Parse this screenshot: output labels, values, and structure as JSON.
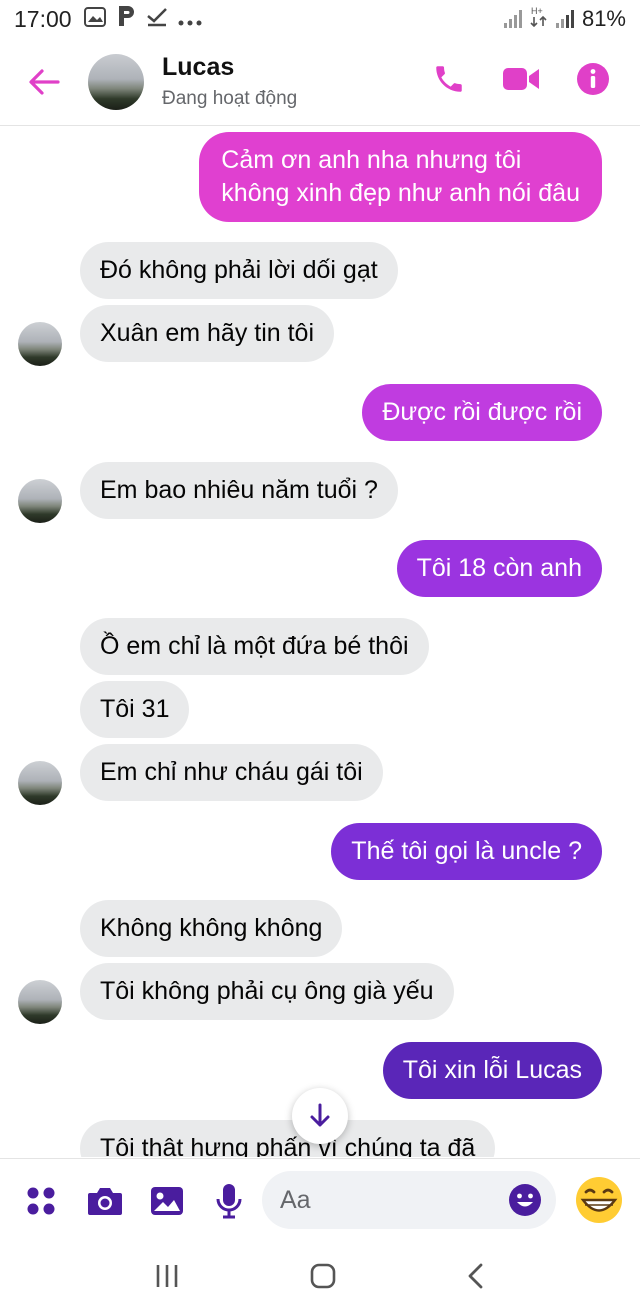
{
  "status_bar": {
    "time": "17:00",
    "battery": "81%",
    "icons": [
      "gallery-icon",
      "parking-icon",
      "check-download-icon",
      "more-dots-icon",
      "signal-icon",
      "data-icon"
    ]
  },
  "header": {
    "contact_name": "Lucas",
    "presence": "Đang hoạt động",
    "accent_color": "#e040c8"
  },
  "messages": [
    {
      "side": "out",
      "text": "Cảm ơn anh nha nhưng tôi",
      "text2": "không xinh đẹp như anh nói đâu",
      "color": "#e040d0"
    },
    {
      "side": "in",
      "text": "Đó không phải lời dối gạt"
    },
    {
      "side": "in",
      "text": "Xuân em hãy tin tôi",
      "avatar": true
    },
    {
      "side": "out",
      "text": "Được rồi được rồi",
      "color": "#c03ce0"
    },
    {
      "side": "in",
      "text": "Em bao nhiêu năm tuổi ?",
      "avatar": true
    },
    {
      "side": "out",
      "text": "Tôi 18 còn anh",
      "color": "#9b34e0"
    },
    {
      "side": "in",
      "text": "Ồ em chỉ là một đứa bé thôi"
    },
    {
      "side": "in",
      "text": "Tôi 31"
    },
    {
      "side": "in",
      "text": "Em chỉ như cháu gái tôi",
      "avatar": true
    },
    {
      "side": "out",
      "text": "Thế tôi gọi là uncle ?",
      "color": "#7c2fd6"
    },
    {
      "side": "in",
      "text": "Không không không"
    },
    {
      "side": "in",
      "text": "Tôi không phải cụ ông già yếu",
      "avatar": true
    },
    {
      "side": "out",
      "text": "Tôi xin lỗi Lucas",
      "color": "#5a26b8"
    },
    {
      "side": "in",
      "text": "Tôi thật hưng phấn vì chúng ta đã"
    }
  ],
  "composer": {
    "placeholder": "Aa",
    "icon_color": "#4a1d9e"
  }
}
